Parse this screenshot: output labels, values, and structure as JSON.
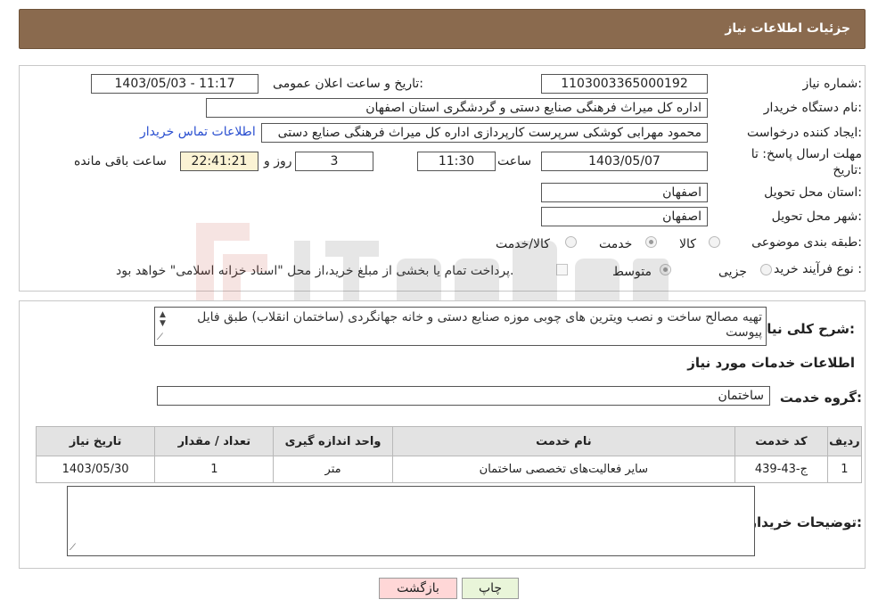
{
  "header": {
    "title": "جزئیات اطلاعات نیاز"
  },
  "info": {
    "need_number_label": "شماره نیاز:",
    "need_number": "1103003365000192",
    "announce_label": "تاریخ و ساعت اعلان عمومی:",
    "announce_value": "1403/05/03 - 11:17",
    "buyer_org_label": "نام دستگاه خریدار:",
    "buyer_org": "اداره کل میراث فرهنگی  صنایع دستی و گردشگری استان اصفهان",
    "creator_label": "ایجاد کننده درخواست:",
    "creator": "محمود مهرابی کوشکی سرپرست کارپردازی اداره کل میراث فرهنگی  صنایع دستی",
    "contact_link": "اطلاعات تماس خریدار",
    "deadline_label": "مهلت ارسال پاسخ: تا تاریخ:",
    "deadline_date": "1403/05/07",
    "time_label": "ساعت",
    "deadline_time": "11:30",
    "days_value": "3",
    "days_label": "روز و",
    "remaining_time": "22:41:21",
    "remaining_label": "ساعت باقی مانده",
    "province_label": "استان محل تحویل:",
    "province": "اصفهان",
    "city_label": "شهر محل تحویل:",
    "city": "اصفهان",
    "category_label": "طبقه بندی موضوعی:",
    "category_options": [
      "کالا",
      "خدمت",
      "کالا/خدمت"
    ],
    "category_selected": "خدمت",
    "process_label": "نوع فرآیند خرید :",
    "process_options": [
      "جزیی",
      "متوسط"
    ],
    "process_selected": "متوسط",
    "payment_note": "پرداخت تمام یا بخشی از مبلغ خرید،از محل \"اسناد خزانه اسلامی\" خواهد بود."
  },
  "details": {
    "description_label": "شرح کلی نیاز:",
    "description": "تهیه مصالح ساخت و نصب ویترین های چوبی موزه صنایع دستی و خانه جهانگردی (ساختمان انقلاب) طبق فایل پیوست",
    "services_heading": "اطلاعات خدمات مورد نیاز",
    "service_group_label": "گروه خدمت:",
    "service_group": "ساختمان",
    "table": {
      "headers": [
        "ردیف",
        "کد خدمت",
        "نام خدمت",
        "واحد اندازه گیری",
        "تعداد / مقدار",
        "تاریخ نیاز"
      ],
      "rows": [
        [
          "1",
          "ج-43-439",
          "سایر فعالیت‌های تخصصی ساختمان",
          "متر",
          "1",
          "1403/05/30"
        ]
      ]
    },
    "buyer_notes_label": "توضیحات خریدار:",
    "buyer_notes": ""
  },
  "buttons": {
    "print": "چاپ",
    "back": "بازگشت"
  },
  "watermark": {
    "text": "AriaTender.neT"
  }
}
